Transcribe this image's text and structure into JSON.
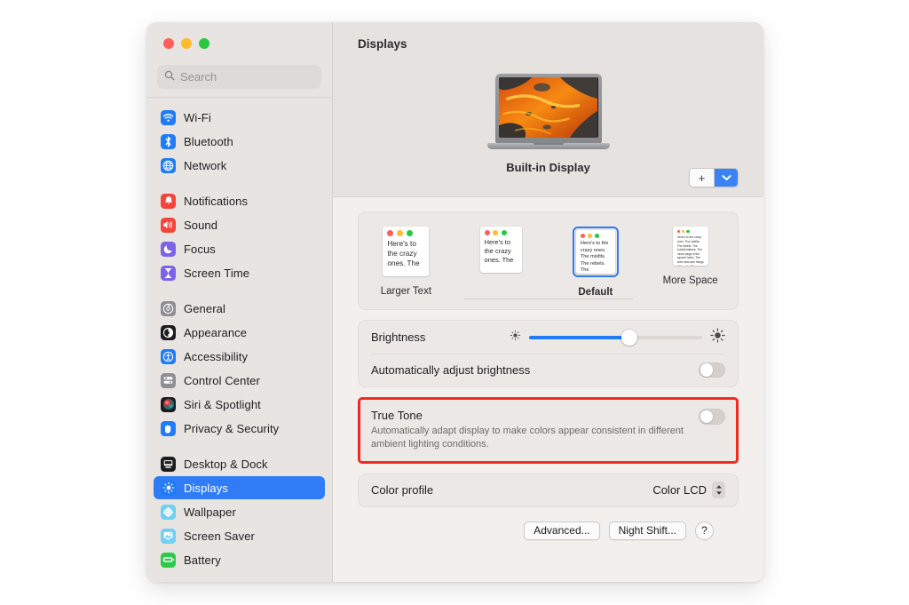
{
  "window": {
    "traffic_lights": [
      "close",
      "minimize",
      "zoom"
    ],
    "colors": {
      "accent": "#2f7cf6",
      "highlight_box": "#f42b1c",
      "sidebar_bg": "#e8e4e2",
      "content_bg": "#f2efec",
      "topbar_bg": "#e6e2e0"
    }
  },
  "search": {
    "placeholder": "Search",
    "icon": "search-icon"
  },
  "sidebar": {
    "groups": [
      {
        "items": [
          {
            "label": "Wi-Fi",
            "icon": "wifi-icon",
            "selected": false
          },
          {
            "label": "Bluetooth",
            "icon": "bluetooth-icon",
            "selected": false
          },
          {
            "label": "Network",
            "icon": "network-globe-icon",
            "selected": false
          }
        ]
      },
      {
        "items": [
          {
            "label": "Notifications",
            "icon": "bell-icon",
            "selected": false
          },
          {
            "label": "Sound",
            "icon": "speaker-icon",
            "selected": false
          },
          {
            "label": "Focus",
            "icon": "moon-icon",
            "selected": false
          },
          {
            "label": "Screen Time",
            "icon": "hourglass-icon",
            "selected": false
          }
        ]
      },
      {
        "items": [
          {
            "label": "General",
            "icon": "gear-icon",
            "selected": false
          },
          {
            "label": "Appearance",
            "icon": "appearance-contrast-icon",
            "selected": false
          },
          {
            "label": "Accessibility",
            "icon": "accessibility-person-icon",
            "selected": false
          },
          {
            "label": "Control Center",
            "icon": "control-center-icon",
            "selected": false
          },
          {
            "label": "Siri & Spotlight",
            "icon": "siri-orb-icon",
            "selected": false
          },
          {
            "label": "Privacy & Security",
            "icon": "hand-privacy-icon",
            "selected": false
          }
        ]
      },
      {
        "items": [
          {
            "label": "Desktop & Dock",
            "icon": "desktop-dock-icon",
            "selected": false
          },
          {
            "label": "Displays",
            "icon": "brightness-sun-icon",
            "selected": true
          },
          {
            "label": "Wallpaper",
            "icon": "wallpaper-flower-icon",
            "selected": false
          },
          {
            "label": "Screen Saver",
            "icon": "screen-saver-icon",
            "selected": false
          },
          {
            "label": "Battery",
            "icon": "battery-icon",
            "selected": false
          }
        ]
      }
    ]
  },
  "main": {
    "title": "Displays",
    "display": {
      "name": "Built-in Display",
      "thumbnail": "macbook-lava-wallpaper"
    },
    "add_display": {
      "plus_label": "+",
      "chevron_icon": "chevron-down-icon"
    },
    "resolutions": {
      "options": [
        {
          "label": "Larger Text",
          "selected": false,
          "text_scale": "xl"
        },
        {
          "label": "",
          "selected": false,
          "text_scale": "lg"
        },
        {
          "label": "Default",
          "selected": true,
          "text_scale": "md"
        },
        {
          "label": "More Space",
          "selected": false,
          "text_scale": "sm"
        }
      ],
      "preview_text": "Here's to the crazy ones. The misfits. The rebels. The troublemakers. The round pegs in the square holes. The ones who see things differently. They're not fond of rules. And they have no respect for the status quo. You can quote them, disagree with them, glorify or vilify them. About the only thing you can't do is ignore them. Because they change things."
    },
    "brightness": {
      "label": "Brightness",
      "value_percent": 58,
      "icon_low": "brightness-low-icon",
      "icon_high": "brightness-high-icon"
    },
    "auto_brightness": {
      "label": "Automatically adjust brightness",
      "enabled": false
    },
    "true_tone": {
      "label": "True Tone",
      "description": "Automatically adapt display to make colors appear consistent in different ambient lighting conditions.",
      "enabled": false,
      "highlighted": true
    },
    "color_profile": {
      "label": "Color profile",
      "value": "Color LCD",
      "icon": "up-down-stepper-icon"
    },
    "footer_buttons": [
      {
        "label": "Advanced...",
        "name": "advanced-button"
      },
      {
        "label": "Night Shift...",
        "name": "night-shift-button"
      },
      {
        "label": "?",
        "name": "help-button"
      }
    ]
  }
}
